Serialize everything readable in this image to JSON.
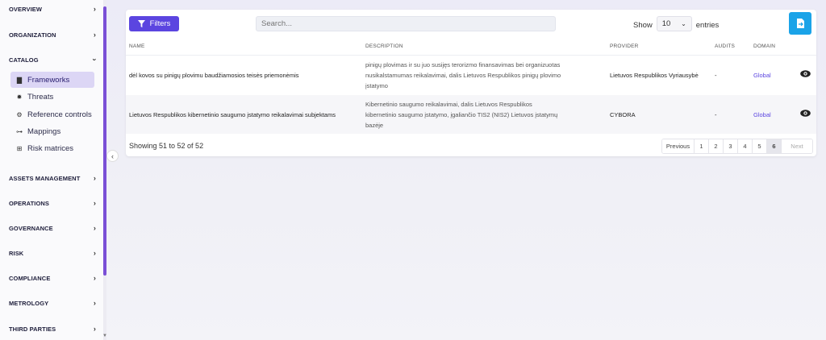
{
  "sidebar": {
    "sections_top": [
      {
        "label": "OVERVIEW",
        "expanded": false
      },
      {
        "label": "ORGANIZATION",
        "expanded": false
      },
      {
        "label": "CATALOG",
        "expanded": true
      }
    ],
    "catalog_items": [
      {
        "label": "Frameworks",
        "icon": "book-icon",
        "active": true
      },
      {
        "label": "Threats",
        "icon": "bug-icon",
        "active": false
      },
      {
        "label": "Reference controls",
        "icon": "gears-icon",
        "active": false
      },
      {
        "label": "Mappings",
        "icon": "diagram-icon",
        "active": false
      },
      {
        "label": "Risk matrices",
        "icon": "table-icon",
        "active": false
      }
    ],
    "sections_bottom": [
      {
        "label": "ASSETS MANAGEMENT"
      },
      {
        "label": "OPERATIONS"
      },
      {
        "label": "GOVERNANCE"
      },
      {
        "label": "RISK"
      },
      {
        "label": "COMPLIANCE"
      },
      {
        "label": "METROLOGY"
      },
      {
        "label": "THIRD PARTIES"
      }
    ]
  },
  "toolbar": {
    "filters_label": "Filters",
    "search_placeholder": "Search...",
    "show_label": "Show",
    "show_value": "10",
    "entries_label": "entries"
  },
  "table": {
    "headers": {
      "name": "NAME",
      "description": "DESCRIPTION",
      "provider": "PROVIDER",
      "audits": "AUDITS",
      "domain": "DOMAIN"
    },
    "rows": [
      {
        "name": "dėl kovos su pinigų plovimu baudžiamosios teisės priemonėmis",
        "description_lines": [
          "pinigų plovimas ir su juo susijęs terorizmo finansavimas bei organizuotas",
          "nusikalstamumas reikalavimai, dalis Lietuvos Respublikos pinigų plovimo",
          "įstatymo"
        ],
        "provider": "Lietuvos Respublikos Vyriausybė",
        "audits": "-",
        "domain": "Global"
      },
      {
        "name": "Lietuvos Respublikos kibernetinio saugumo įstatymo reikalavimai subjektams",
        "description_lines": [
          "Kibernetinio saugumo reikalavimai, dalis Lietuvos Respublikos",
          "kibernetinio saugumo įstatymo, įgaliančio TIS2 (NIS2) Lietuvos įstatymų",
          "bazėje"
        ],
        "provider": "CYBORA",
        "audits": "-",
        "domain": "Global"
      }
    ]
  },
  "footer": {
    "showing_text": "Showing 51 to 52 of 52",
    "pagination": {
      "previous": "Previous",
      "pages": [
        "1",
        "2",
        "3",
        "4",
        "5",
        "6"
      ],
      "active": "6",
      "next": "Next"
    }
  },
  "colors": {
    "accent": "#5b45e0",
    "export": "#1aa3e8",
    "scrollbar": "#7a4fd6"
  }
}
